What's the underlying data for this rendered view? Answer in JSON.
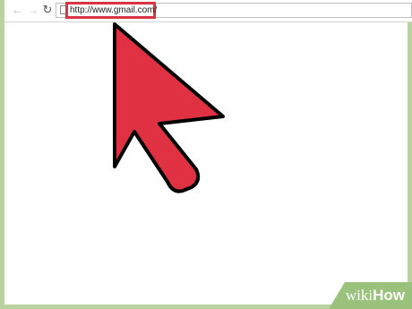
{
  "browser": {
    "url": "http://www.gmail.com/",
    "icons": {
      "back": "back-arrow-icon",
      "forward": "forward-arrow-icon",
      "reload": "reload-icon",
      "page": "page-icon"
    }
  },
  "cursor": {
    "icon": "arrow-cursor-icon",
    "fill": "#e03142",
    "stroke": "#000000"
  },
  "watermark": {
    "part1": "wiki",
    "part2": "How",
    "color": "#9bc27d"
  },
  "colors": {
    "highlight": "#d83444",
    "frame": "#b8d3a0"
  }
}
